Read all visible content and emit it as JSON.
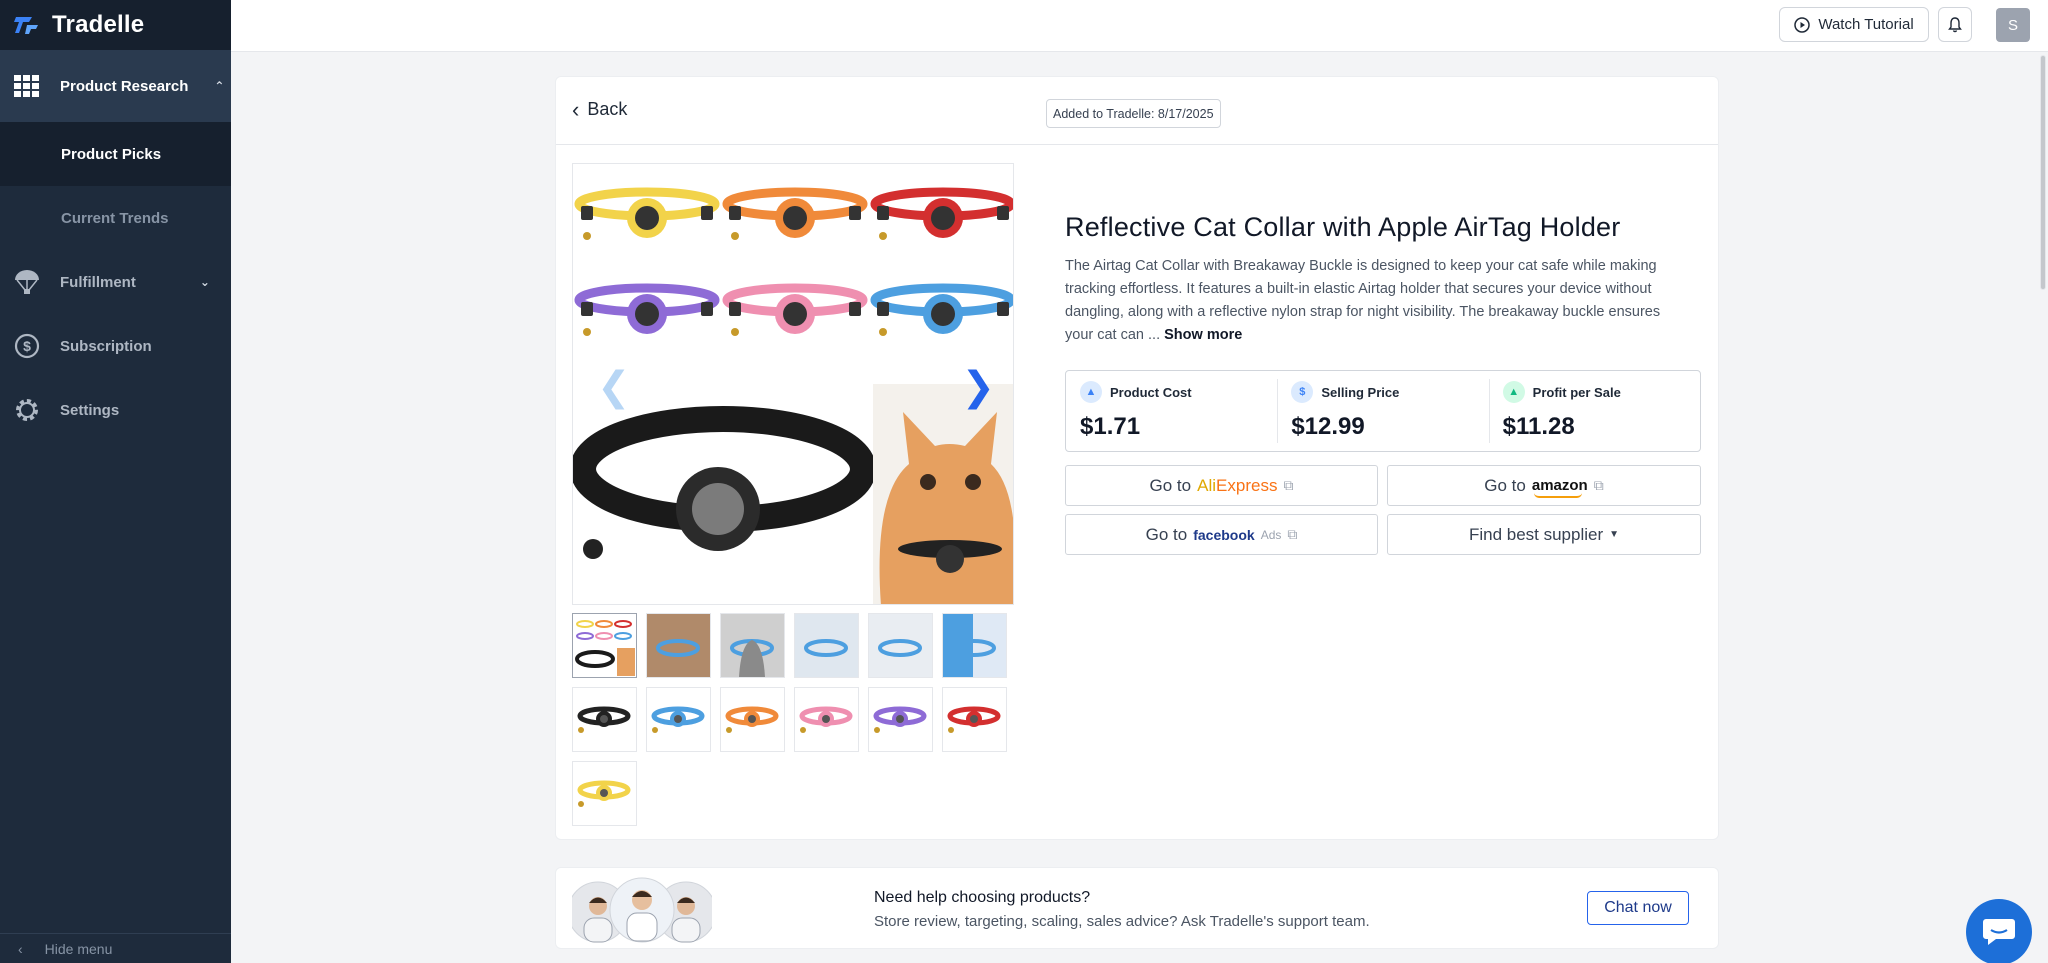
{
  "app": {
    "name": "Tradelle"
  },
  "sidebar": {
    "items": [
      {
        "label": "Product Research",
        "icon": "grid-icon",
        "expanded": true,
        "children": [
          {
            "label": "Product Picks",
            "active": true
          },
          {
            "label": "Current Trends",
            "active": false
          }
        ]
      },
      {
        "label": "Fulfillment",
        "icon": "parachute-icon"
      },
      {
        "label": "Subscription",
        "icon": "dollar-circle-icon"
      },
      {
        "label": "Settings",
        "icon": "gear-icon"
      }
    ],
    "hide_menu": "Hide menu"
  },
  "topbar": {
    "watch_tutorial": "Watch Tutorial",
    "avatar_initial": "S"
  },
  "card": {
    "back": "Back",
    "added": "Added to Tradelle: 8/17/2025"
  },
  "product": {
    "title": "Reflective Cat Collar with Apple AirTag Holder",
    "description": "The Airtag Cat Collar with Breakaway Buckle is designed to keep your cat safe while making tracking effortless. It features a built-in elastic Airtag holder that secures your device without dangling, along with a reflective nylon strap for night visibility. The breakaway buckle ensures your cat can ...",
    "show_more": "Show more",
    "stats": [
      {
        "label": "Product Cost",
        "value": "$1.71",
        "icon": "shipping-icon",
        "color": "#3b82f6"
      },
      {
        "label": "Selling Price",
        "value": "$12.99",
        "icon": "price-tag-icon",
        "color": "#3b82f6"
      },
      {
        "label": "Profit per Sale",
        "value": "$11.28",
        "icon": "money-bag-icon",
        "color": "#10b981"
      }
    ],
    "links": {
      "go_to": "Go to",
      "aliexpress_a": "Ali",
      "aliexpress_b": "Express",
      "amazon": "amazon",
      "facebook": "facebook",
      "facebook_ads": "Ads",
      "find_supplier": "Find best supplier"
    },
    "collar_colors": [
      "#f2d34a",
      "#f08a3a",
      "#d32f2f",
      "#8e6bd6",
      "#ef8fb0",
      "#4d9fe0",
      "#222222"
    ],
    "thumb_colors": [
      "#222222",
      "#4d9fe0",
      "#f08a3a",
      "#ef8fb0",
      "#8e6bd6",
      "#d32f2f",
      "#f2d34a"
    ]
  },
  "help": {
    "title": "Need help choosing products?",
    "subtitle": "Store review, targeting, scaling, sales advice? Ask Tradelle's support team.",
    "chat": "Chat now"
  }
}
